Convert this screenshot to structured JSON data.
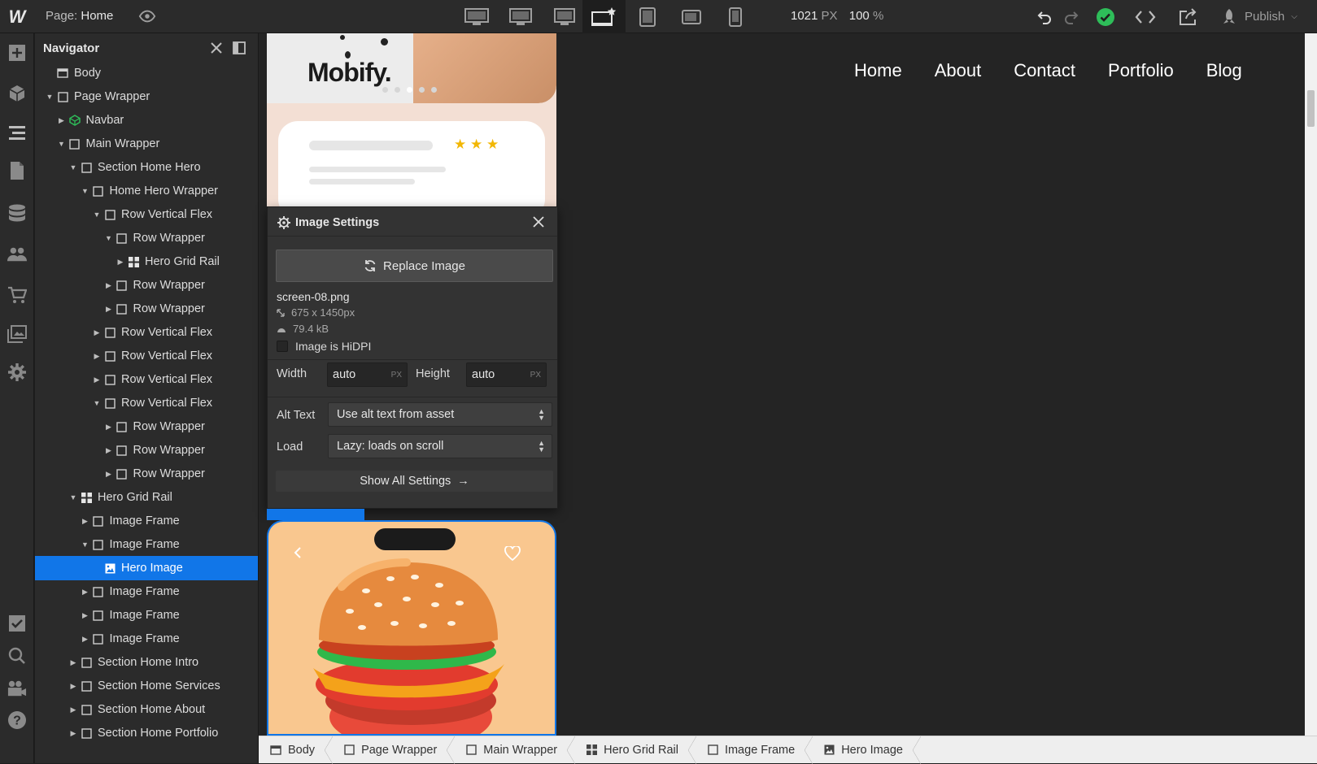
{
  "topbar": {
    "logo": "W",
    "page_prefix": "Page:",
    "page_name": "Home",
    "width_value": "1021",
    "width_unit": "PX",
    "zoom_value": "100",
    "zoom_unit": "%",
    "publish_label": "Publish",
    "breakpoints": [
      "desktop-xxl-icon",
      "desktop-xl-icon",
      "desktop-large-icon",
      "desktop-base-icon",
      "tablet-icon",
      "mobile-landscape-icon",
      "mobile-portrait-icon"
    ],
    "status_color": "#2ebd59"
  },
  "navigator": {
    "title": "Navigator",
    "items": [
      {
        "label": "Body",
        "depth": 0,
        "caret": "none",
        "icon": "body"
      },
      {
        "label": "Page Wrapper",
        "depth": 0,
        "caret": "open",
        "icon": "box"
      },
      {
        "label": "Navbar",
        "depth": 1,
        "caret": "closed",
        "icon": "symbol"
      },
      {
        "label": "Main Wrapper",
        "depth": 1,
        "caret": "open",
        "icon": "box"
      },
      {
        "label": "Section Home Hero",
        "depth": 2,
        "caret": "open",
        "icon": "box"
      },
      {
        "label": "Home Hero Wrapper",
        "depth": 3,
        "caret": "open",
        "icon": "box"
      },
      {
        "label": "Row Vertical Flex",
        "depth": 4,
        "caret": "open",
        "icon": "box"
      },
      {
        "label": "Row Wrapper",
        "depth": 5,
        "caret": "open",
        "icon": "box"
      },
      {
        "label": "Hero Grid Rail",
        "depth": 6,
        "caret": "closed",
        "icon": "grid"
      },
      {
        "label": "Row Wrapper",
        "depth": 5,
        "caret": "closed",
        "icon": "box"
      },
      {
        "label": "Row Wrapper",
        "depth": 5,
        "caret": "closed",
        "icon": "box"
      },
      {
        "label": "Row Vertical Flex",
        "depth": 4,
        "caret": "closed",
        "icon": "box"
      },
      {
        "label": "Row Vertical Flex",
        "depth": 4,
        "caret": "closed",
        "icon": "box"
      },
      {
        "label": "Row Vertical Flex",
        "depth": 4,
        "caret": "closed",
        "icon": "box"
      },
      {
        "label": "Row Vertical Flex",
        "depth": 4,
        "caret": "open",
        "icon": "box"
      },
      {
        "label": "Row Wrapper",
        "depth": 5,
        "caret": "closed",
        "icon": "box"
      },
      {
        "label": "Row Wrapper",
        "depth": 5,
        "caret": "closed",
        "icon": "box"
      },
      {
        "label": "Row Wrapper",
        "depth": 5,
        "caret": "closed",
        "icon": "box"
      },
      {
        "label": "Hero Grid Rail",
        "depth": 2,
        "caret": "open",
        "icon": "grid"
      },
      {
        "label": "Image Frame",
        "depth": 3,
        "caret": "closed",
        "icon": "box"
      },
      {
        "label": "Image Frame",
        "depth": 3,
        "caret": "open",
        "icon": "box"
      },
      {
        "label": "Hero Image",
        "depth": 4,
        "caret": "none",
        "icon": "image",
        "selected": true
      },
      {
        "label": "Image Frame",
        "depth": 3,
        "caret": "closed",
        "icon": "box"
      },
      {
        "label": "Image Frame",
        "depth": 3,
        "caret": "closed",
        "icon": "box"
      },
      {
        "label": "Image Frame",
        "depth": 3,
        "caret": "closed",
        "icon": "box"
      },
      {
        "label": "Section Home Intro",
        "depth": 2,
        "caret": "closed",
        "icon": "box"
      },
      {
        "label": "Section Home Services",
        "depth": 2,
        "caret": "closed",
        "icon": "box"
      },
      {
        "label": "Section Home About",
        "depth": 2,
        "caret": "closed",
        "icon": "box"
      },
      {
        "label": "Section Home Portfolio",
        "depth": 2,
        "caret": "closed",
        "icon": "box"
      }
    ]
  },
  "site_nav": [
    "Home",
    "About",
    "Contact",
    "Portfolio",
    "Blog"
  ],
  "mockup": {
    "brand": "Mobify."
  },
  "image_settings": {
    "title": "Image Settings",
    "replace_label": "Replace Image",
    "file_name": "screen-08.png",
    "dimensions": "675 x 1450px",
    "file_size": "79.4 kB",
    "hidpi_label": "Image is HiDPI",
    "width_label": "Width",
    "width_value": "auto",
    "height_label": "Height",
    "height_value": "auto",
    "unit": "PX",
    "alt_label": "Alt Text",
    "alt_value": "Use alt text from asset",
    "load_label": "Load",
    "load_value": "Lazy: loads on scroll",
    "show_all_label": "Show All Settings",
    "arrow": "→"
  },
  "breadcrumb": [
    {
      "label": "Body",
      "icon": "body"
    },
    {
      "label": "Page Wrapper",
      "icon": "box"
    },
    {
      "label": "Main Wrapper",
      "icon": "box"
    },
    {
      "label": "Hero Grid Rail",
      "icon": "grid"
    },
    {
      "label": "Image Frame",
      "icon": "box"
    },
    {
      "label": "Hero Image",
      "icon": "image"
    }
  ],
  "colors": {
    "accent": "#1176e8",
    "panel": "#2b2b2b",
    "canvas": "#242424"
  }
}
